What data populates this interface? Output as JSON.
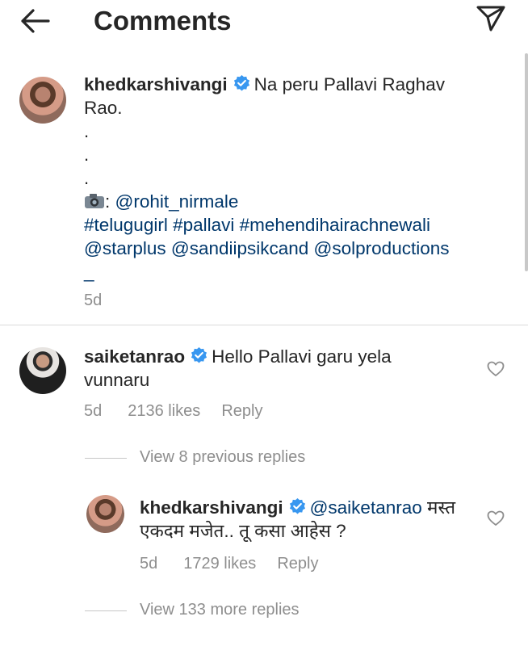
{
  "header": {
    "title": "Comments",
    "back_icon": "arrow-left-icon",
    "share_icon": "paper-plane-icon"
  },
  "caption": {
    "username": "khedkarshivangi",
    "text_line1": "Na peru Pallavi Raghav",
    "text_line2": "Rao.",
    "dots": [
      ".",
      ".",
      "."
    ],
    "camera_suffix": ":",
    "photographer": "@rohit_nirmale",
    "hashtags": "#telugugirl #pallavi #mehendihairachnewali",
    "mentions": "@starplus @sandiipsikcand @solproductions",
    "trailing": "_",
    "time": "5d"
  },
  "comment": {
    "username": "saiketanrao",
    "text_line1": "Hello Pallavi garu yela",
    "text_line2": "vunnaru",
    "time": "5d",
    "likes": "2136 likes",
    "reply": "Reply"
  },
  "view_previous": "View 8 previous replies",
  "reply": {
    "username": "khedkarshivangi",
    "mention": "@saiketanrao",
    "text_line1_rest": "मस्त",
    "text_line2": "एकदम मजेत.. तू कसा आहेस ?",
    "time": "5d",
    "likes": "1729 likes",
    "reply": "Reply"
  },
  "view_more": "View 133 more replies",
  "colors": {
    "text": "#262626",
    "muted": "#8e8e8e",
    "link": "#00376b",
    "verified": "#3897f0"
  }
}
